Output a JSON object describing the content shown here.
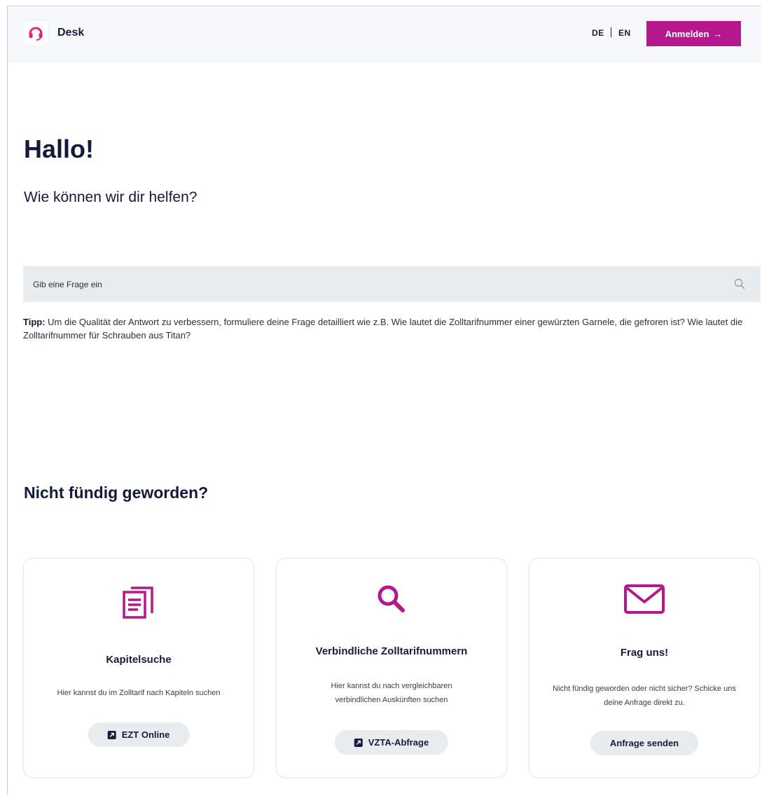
{
  "header": {
    "brand": "Desk",
    "lang_de": "DE",
    "lang_en": "EN",
    "login_label": "Anmelden",
    "login_arrow": "→"
  },
  "hero": {
    "title": "Hallo!",
    "subtitle": "Wie können wir dir helfen?"
  },
  "search": {
    "placeholder": "Gib eine Frage ein"
  },
  "tip": {
    "label": "Tipp:",
    "text": " Um die Qualität der Antwort zu verbessern, formuliere deine Frage detailliert wie z.B. Wie lautet die Zolltarifnummer einer gewürzten Garnele, die gefroren ist? Wie lautet die Zolltarifnummer für Schrauben aus Titan?"
  },
  "section": {
    "title": "Nicht fündig geworden?"
  },
  "cards": [
    {
      "icon": "document-list-icon",
      "title": "Kapitelsuche",
      "description": "Hier kannst du im Zolltarif nach Kapiteln suchen",
      "button": "EZT Online"
    },
    {
      "icon": "magnifier-icon",
      "title": "Verbindliche Zolltarifnummern",
      "description": "Hier kannst du nach vergleichbaren verbindlichen Auskünften suchen",
      "button": "VZTA-Abfrage"
    },
    {
      "icon": "envelope-icon",
      "title": "Frag uns!",
      "description": "Nicht fündig geworden oder nicht sicher? Schicke uns deine Anfrage direkt zu.",
      "button": "Anfrage senden"
    }
  ],
  "colors": {
    "accent": "#b5178c",
    "navy": "#141a3a",
    "search_bg": "#e9ecef"
  }
}
